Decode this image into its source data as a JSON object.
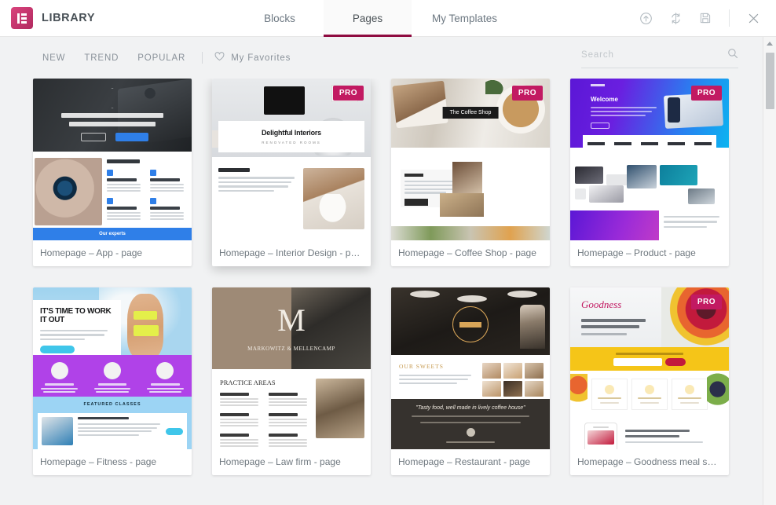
{
  "header": {
    "brand_title": "LIBRARY",
    "logo_icon": "elementor-logo-icon",
    "tabs": [
      {
        "label": "Blocks",
        "active": false
      },
      {
        "label": "Pages",
        "active": true
      },
      {
        "label": "My Templates",
        "active": false
      }
    ],
    "actions": [
      {
        "name": "upload-icon",
        "title": "Import Template"
      },
      {
        "name": "sync-icon",
        "title": "Sync Library"
      },
      {
        "name": "save-icon",
        "title": "Save"
      },
      {
        "name": "close-icon",
        "title": "Close"
      }
    ],
    "accent_color": "#8e0b40"
  },
  "toolbar": {
    "filters": [
      {
        "label": "New"
      },
      {
        "label": "Trend"
      },
      {
        "label": "Popular"
      }
    ],
    "favorites_label": "My Favorites",
    "favorites_icon": "heart-icon",
    "search": {
      "placeholder": "Search",
      "value": "",
      "icon": "search-icon"
    }
  },
  "grid": {
    "pro_badge_label": "PRO",
    "pro_badge_color": "#c21a62",
    "cards": [
      {
        "title": "Homepage – App - page",
        "pro": false,
        "hovered": false,
        "art": "app"
      },
      {
        "title": "Homepage – Interior Design - page",
        "pro": true,
        "hovered": true,
        "art": "interior"
      },
      {
        "title": "Homepage – Coffee Shop - page",
        "pro": true,
        "hovered": false,
        "art": "coffee"
      },
      {
        "title": "Homepage – Product - page",
        "pro": true,
        "hovered": false,
        "art": "product"
      },
      {
        "title": "Homepage – Fitness - page",
        "pro": false,
        "hovered": false,
        "art": "fitness"
      },
      {
        "title": "Homepage – Law firm - page",
        "pro": false,
        "hovered": false,
        "art": "law"
      },
      {
        "title": "Homepage – Restaurant - page",
        "pro": false,
        "hovered": false,
        "art": "restaurant"
      },
      {
        "title": "Homepage – Goodness meal servi…",
        "pro": true,
        "hovered": false,
        "art": "goodness"
      }
    ]
  },
  "thumb_text": {
    "app_headline_1": "Manage All Your Daily Tasks",
    "app_headline_2": "Through A Single App",
    "app_cta": "Our experts",
    "interior_title": "Delightful Interiors",
    "interior_sub": "RENOVATED ROOMS",
    "coffee_sign": "The Coffee Shop",
    "product_welcome": "Welcome",
    "fitness_headline": "IT'S TIME TO WORK IT OUT",
    "law_monogram": "M",
    "law_name": "MARKOWITZ & MELLENCAMP",
    "restaurant_quote": "\"Tasty food, well made in lively coffee house\"",
    "goodness_logo": "Goodness"
  },
  "scrollbar": {
    "up_arrow_icon": "caret-up-icon",
    "thumb_name": "scrollbar-thumb"
  }
}
